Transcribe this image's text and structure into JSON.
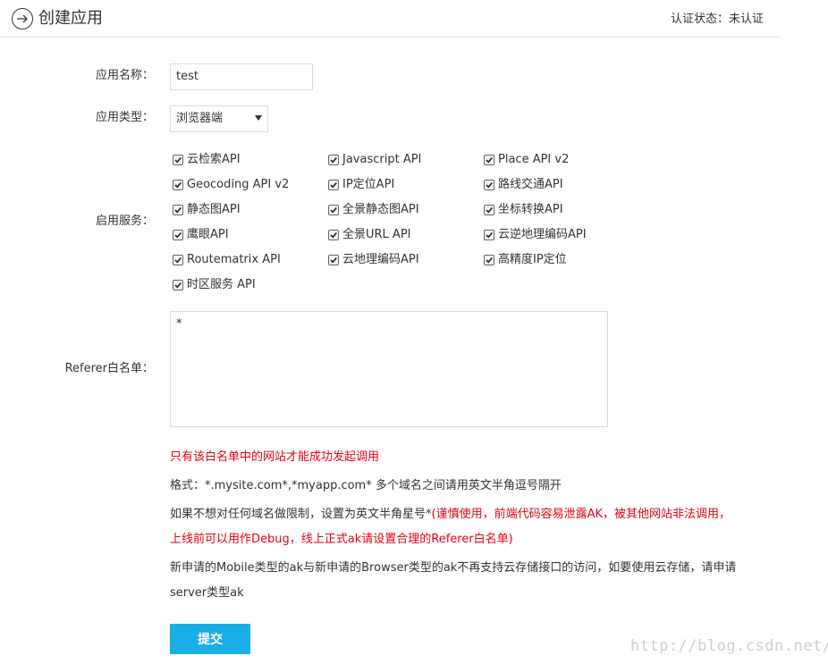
{
  "header": {
    "title": "创建应用",
    "cert_status": "认证状态：未认证"
  },
  "form": {
    "app_name_label": "应用名称：",
    "app_name_value": "test",
    "app_type_label": "应用类型：",
    "app_type_value": "浏览器端",
    "services_label": "启用服务：",
    "services": [
      {
        "label": "云检索API",
        "checked": true
      },
      {
        "label": "Javascript API",
        "checked": true
      },
      {
        "label": "Place API v2",
        "checked": true
      },
      {
        "label": "Geocoding API v2",
        "checked": true
      },
      {
        "label": "IP定位API",
        "checked": true
      },
      {
        "label": "路线交通API",
        "checked": true
      },
      {
        "label": "静态图API",
        "checked": true
      },
      {
        "label": "全景静态图API",
        "checked": true
      },
      {
        "label": "坐标转换API",
        "checked": true
      },
      {
        "label": "鹰眼API",
        "checked": true
      },
      {
        "label": "全景URL API",
        "checked": true
      },
      {
        "label": "云逆地理编码API",
        "checked": true
      },
      {
        "label": "Routematrix API",
        "checked": true
      },
      {
        "label": "云地理编码API",
        "checked": true
      },
      {
        "label": "高精度IP定位",
        "checked": true
      },
      {
        "label": "时区服务 API",
        "checked": true
      }
    ],
    "referer_label": "Referer白名单：",
    "referer_value": "*",
    "note_whitelist": "只有该白名单中的网站才能成功发起调用",
    "note_format": "格式：*.mysite.com*,*myapp.com* 多个域名之间请用英文半角逗号隔开",
    "note_star_prefix": "如果不想对任何域名做限制，设置为英文半角星号*",
    "note_star_warning_1": "(谨慎使用，前端代码容易泄露AK，被其他网站非法调用，",
    "note_star_warning_2": "上线前可以用作Debug，线上正式ak请设置合理的Referer白名单)",
    "note_mobile_1": "新申请的Mobile类型的ak与新申请的Browser类型的ak不再支持云存储接口的访问，如要使用云存储，请申请",
    "note_mobile_2": "server类型ak",
    "submit_label": "提交"
  },
  "watermark": "http://blog.csdn.net/",
  "colors": {
    "accent": "#19aee6",
    "warning": "#e60012"
  }
}
